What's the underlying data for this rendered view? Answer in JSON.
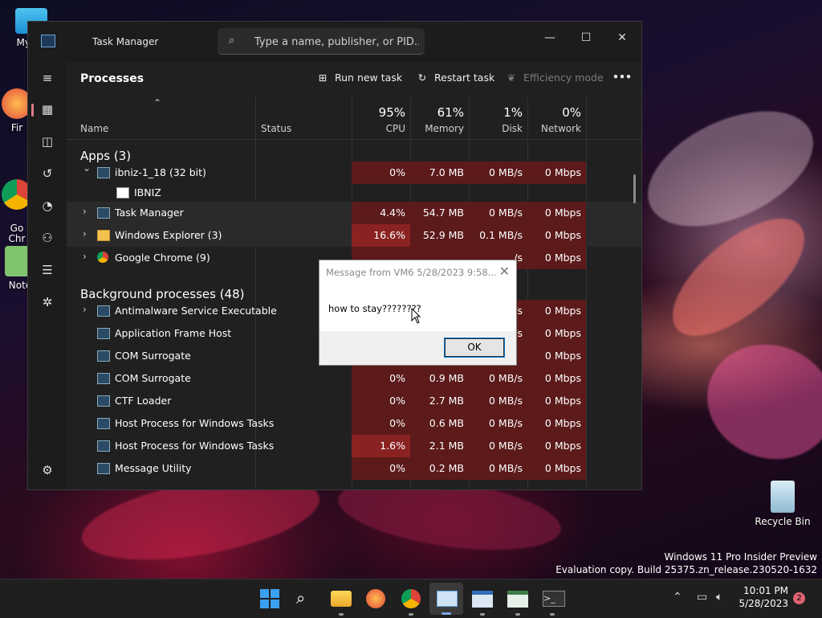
{
  "desktop": {
    "icons": [
      {
        "label": "My Co",
        "name": "my-computer"
      },
      {
        "label": "Fir",
        "name": "firefox"
      },
      {
        "label": "Go\nChr",
        "name": "google-chrome"
      },
      {
        "label": "Note",
        "name": "notepad"
      },
      {
        "label": "Recycle Bin",
        "name": "recycle-bin"
      }
    ],
    "watermark_line1": "Windows 11 Pro Insider Preview",
    "watermark_line2": "Evaluation copy. Build 25375.zn_release.230520-1632"
  },
  "task_manager": {
    "title": "Task Manager",
    "search_placeholder": "Type a name, publisher, or PID...",
    "window_controls": {
      "minimize": "—",
      "maximize": "☐",
      "close": "✕"
    },
    "page_title": "Processes",
    "toolbar": {
      "run_new_task": "Run new task",
      "restart_task": "Restart task",
      "efficiency_mode": "Efficiency mode",
      "more": "•••"
    },
    "columns": {
      "name": "Name",
      "status": "Status",
      "cpu": {
        "label": "CPU",
        "pct": "95%"
      },
      "memory": {
        "label": "Memory",
        "pct": "61%"
      },
      "disk": {
        "label": "Disk",
        "pct": "1%"
      },
      "network": {
        "label": "Network",
        "pct": "0%"
      }
    },
    "apps_header": "Apps (3)",
    "background_header": "Background processes (48)",
    "apps": [
      {
        "name": "ibniz-1_18 (32 bit)",
        "expanded": true,
        "cpu": "0%",
        "memory": "7.0 MB",
        "disk": "0 MB/s",
        "network": "0 Mbps"
      },
      {
        "name": "IBNIZ",
        "child": true,
        "cpu": "",
        "memory": "",
        "disk": "",
        "network": ""
      },
      {
        "name": "Task Manager",
        "cpu": "4.4%",
        "memory": "54.7 MB",
        "disk": "0 MB/s",
        "network": "0 Mbps"
      },
      {
        "name": "Windows Explorer (3)",
        "cpu": "16.6%",
        "memory": "52.9 MB",
        "disk": "0.1 MB/s",
        "network": "0 Mbps"
      },
      {
        "name": "Google Chrome (9)",
        "cpu": "",
        "memory": "",
        "disk": "/s",
        "network": "0 Mbps"
      }
    ],
    "background": [
      {
        "name": "Antimalware Service Executable",
        "cpu": "",
        "memory": "",
        "disk": "/s",
        "network": "0 Mbps"
      },
      {
        "name": "Application Frame Host",
        "cpu": "",
        "memory": "",
        "disk": "/s",
        "network": "0 Mbps"
      },
      {
        "name": "COM Surrogate",
        "cpu": "",
        "memory": "",
        "disk": "",
        "network": "0 Mbps"
      },
      {
        "name": "COM Surrogate",
        "cpu": "0%",
        "memory": "0.9 MB",
        "disk": "0 MB/s",
        "network": "0 Mbps"
      },
      {
        "name": "CTF Loader",
        "cpu": "0%",
        "memory": "2.7 MB",
        "disk": "0 MB/s",
        "network": "0 Mbps"
      },
      {
        "name": "Host Process for Windows Tasks",
        "cpu": "0%",
        "memory": "0.6 MB",
        "disk": "0 MB/s",
        "network": "0 Mbps"
      },
      {
        "name": "Host Process for Windows Tasks",
        "cpu": "1.6%",
        "memory": "2.1 MB",
        "disk": "0 MB/s",
        "network": "0 Mbps"
      },
      {
        "name": "Message Utility",
        "cpu": "0%",
        "memory": "0.2 MB",
        "disk": "0 MB/s",
        "network": "0 Mbps"
      }
    ]
  },
  "dialog": {
    "title": "Message from VM6 5/28/2023 9:58...",
    "message": "how to stay????????",
    "ok_label": "OK",
    "close": "✕"
  },
  "taskbar": {
    "time": "10:01 PM",
    "date": "5/28/2023",
    "notification_count": "2"
  },
  "colors": {
    "cpu_heat_high": "#7a1f1f",
    "cpu_heat_low": "#5a1818",
    "accent": "#0078d4"
  }
}
